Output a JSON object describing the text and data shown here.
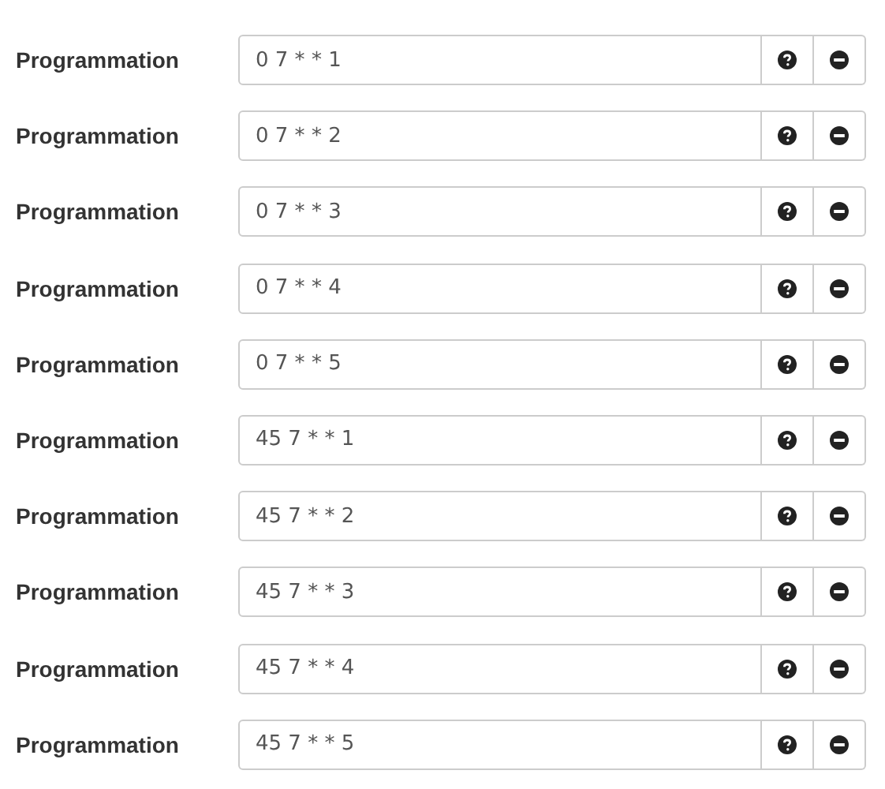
{
  "rows": [
    {
      "label": "Programmation",
      "value": "0 7 * * 1"
    },
    {
      "label": "Programmation",
      "value": "0 7 * * 2"
    },
    {
      "label": "Programmation",
      "value": "0 7 * * 3"
    },
    {
      "label": "Programmation",
      "value": "0 7 * * 4"
    },
    {
      "label": "Programmation",
      "value": "0 7 * * 5"
    },
    {
      "label": "Programmation",
      "value": "45 7 * * 1"
    },
    {
      "label": "Programmation",
      "value": "45 7 * * 2"
    },
    {
      "label": "Programmation",
      "value": "45 7 * * 3"
    },
    {
      "label": "Programmation",
      "value": "45 7 * * 4"
    },
    {
      "label": "Programmation",
      "value": "45 7 * * 5"
    }
  ]
}
